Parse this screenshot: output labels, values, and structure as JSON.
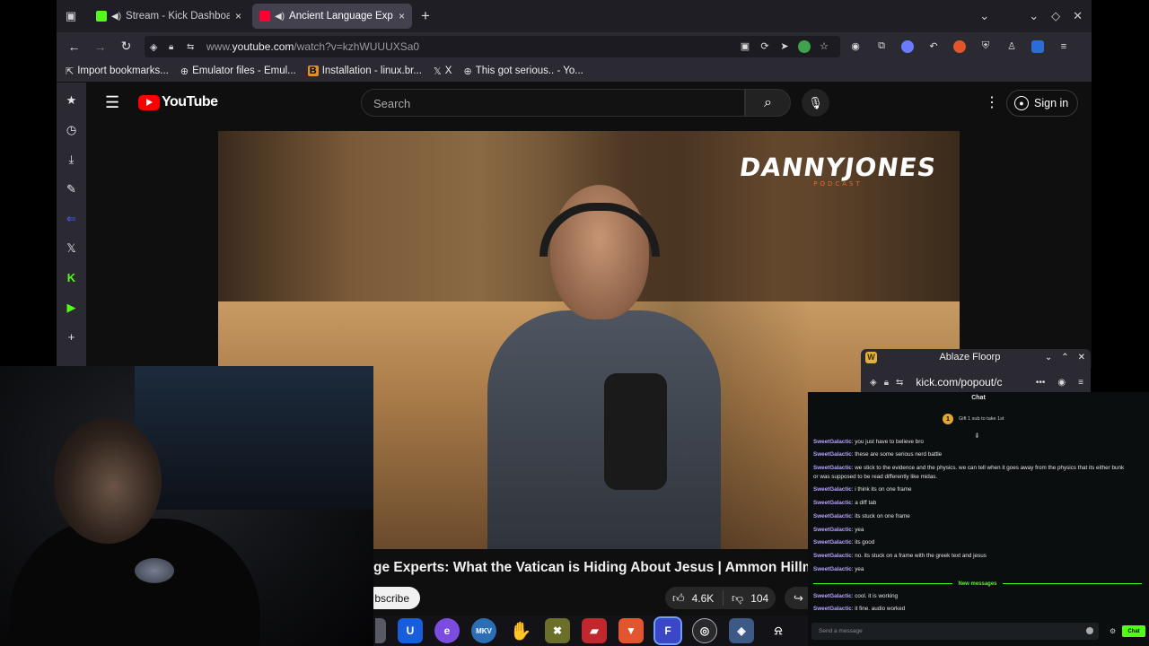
{
  "tabs": [
    {
      "title": "Stream - Kick Dashboard",
      "close": "×",
      "favicon_color": "#53fc18"
    },
    {
      "title": "Ancient Language Experts",
      "close": "×",
      "favicon_color": "#ff0033"
    }
  ],
  "tabbar": {
    "new_tab": "+",
    "list_all": "▣"
  },
  "navbar": {
    "url_dim": "www.",
    "url_main": "youtube.com",
    "url_rest": "/watch?v=kzhWUUUXSa0"
  },
  "bookmarks": [
    {
      "label": "Import bookmarks...",
      "icon": "import-icon"
    },
    {
      "label": "Emulator files - Emul...",
      "icon": "globe-icon"
    },
    {
      "label": "Installation - linux.br...",
      "icon": "b-icon"
    },
    {
      "label": "X",
      "icon": "x-icon"
    },
    {
      "label": "This got serious.. - Yo...",
      "icon": "globe-icon"
    }
  ],
  "youtube": {
    "logo_text": "YouTube",
    "search_placeholder": "Search",
    "sign_in": "Sign in",
    "channel_logo": "DANNYJONES",
    "channel_sub": "PODCAST",
    "video_title": "ge Experts: What the Vatican is Hiding About Jesus | Ammon Hillman",
    "subscribe": "bscribe",
    "likes": "4.6K",
    "dislikes": "104"
  },
  "popup": {
    "title": "Ablaze Floorp",
    "url": "kick.com/popout/c",
    "more": "•••"
  },
  "chat": {
    "header": "Chat",
    "pinned": "Gift 1 sub to take 1st",
    "coin": "1",
    "new_messages": "New messages",
    "input_placeholder": "Send a message",
    "send_button": "Chat",
    "messages": [
      {
        "user": "SweetGalactic",
        "text": ": you just have to believe bro"
      },
      {
        "user": "SweetGalactic",
        "text": ": these are some serious nerd battle"
      },
      {
        "user": "SweetGalactic",
        "text": ": we stick to the evidence and the physics. we can tell when it goes away from the physics that its either bunk"
      },
      {
        "user": "",
        "text": "or was supposed to be read differently like midas."
      },
      {
        "user": "SweetGalactic",
        "text": ": i think its on one frame"
      },
      {
        "user": "SweetGalactic",
        "text": ": a diff tab"
      },
      {
        "user": "SweetGalactic",
        "text": ": its stuck on one frame"
      },
      {
        "user": "SweetGalactic",
        "text": ": yea"
      },
      {
        "user": "SweetGalactic",
        "text": ": its good"
      },
      {
        "user": "SweetGalactic",
        "text": ": no. its stuck on a frame with the greek text and jesus"
      },
      {
        "user": "SweetGalactic",
        "text": ": yea"
      },
      {
        "user": "SweetGalactic",
        "text": ": cool. it is working"
      },
      {
        "user": "SweetGalactic",
        "text": ": it fine. audio worked"
      }
    ]
  },
  "taskbar": [
    {
      "name": "files-icon",
      "color": "#5a5a66",
      "glyph": "▮"
    },
    {
      "name": "bitwarden-icon",
      "color": "#175ddc",
      "glyph": "U"
    },
    {
      "name": "editor-icon",
      "color": "#7b4ce0",
      "glyph": "e"
    },
    {
      "name": "mkv-icon",
      "color": "#2a6fb5",
      "glyph": "MKV"
    },
    {
      "name": "hand-icon",
      "color": "#d9a51c",
      "glyph": "✋"
    },
    {
      "name": "tool-icon",
      "color": "#6b6f2a",
      "glyph": "✖"
    },
    {
      "name": "red-app-icon",
      "color": "#c0282d",
      "glyph": "▰"
    },
    {
      "name": "brave-icon",
      "color": "#e2552f",
      "glyph": "▼"
    },
    {
      "name": "floorp-icon",
      "color": "#3b46c9",
      "glyph": "F"
    },
    {
      "name": "obs-icon",
      "color": "#2a2a2e",
      "glyph": "◎"
    },
    {
      "name": "app-icon",
      "color": "#3d5a86",
      "glyph": "◈"
    },
    {
      "name": "tray-icon",
      "color": "#1a1a1e",
      "glyph": "⍾"
    }
  ]
}
